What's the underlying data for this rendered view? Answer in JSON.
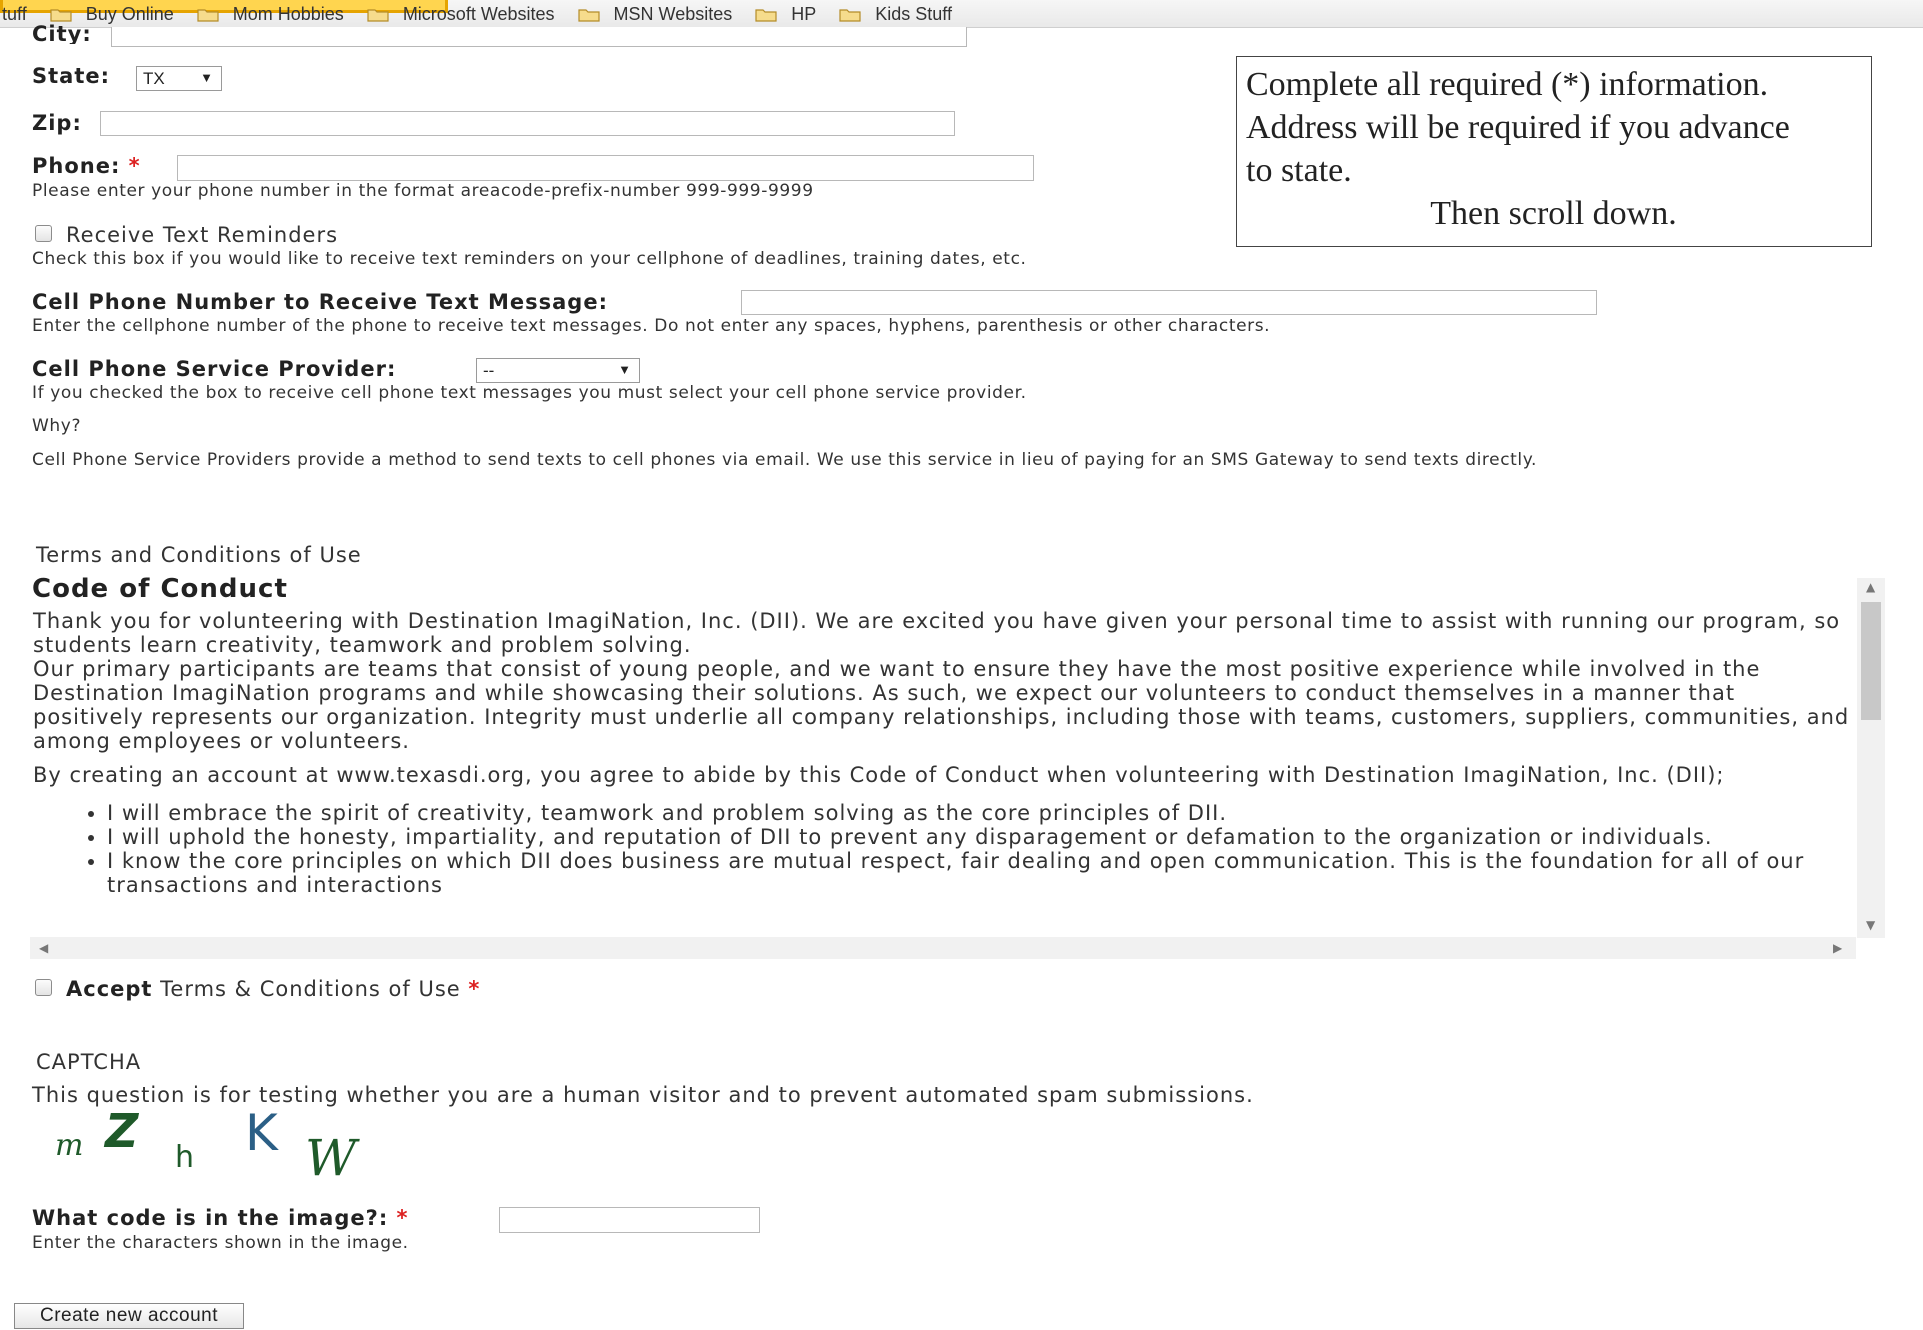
{
  "bookmarks": {
    "items": [
      "tuff",
      "Buy Online",
      "Mom Hobbies",
      "Microsoft Websites",
      "MSN Websites",
      "HP",
      "Kids Stuff"
    ]
  },
  "form": {
    "city_label": "City:",
    "state_label": "State:",
    "state_value": "TX",
    "zip_label": "Zip:",
    "phone_label": "Phone:",
    "required_mark": "*",
    "phone_desc": "Please enter your phone number in the format areacode-prefix-number 999-999-9999",
    "text_reminders_label": "Receive Text Reminders",
    "text_reminders_desc": "Check this box if you would like to receive text reminders on your cellphone of deadlines, training dates, etc.",
    "cell_number_label": "Cell Phone Number to Receive Text Message:",
    "cell_number_desc": "Enter the cellphone number of the phone to receive text messages. Do not enter any spaces, hyphens, parenthesis or other characters.",
    "provider_label": "Cell Phone Service Provider:",
    "provider_value": "--",
    "provider_desc": "If you checked the box to receive cell phone text messages you must select your cell phone service provider.",
    "why": "Why?",
    "why_desc": "Cell Phone Service Providers provide a method to send texts to cell phones via email. We use this service in lieu of paying for an SMS Gateway to send texts directly."
  },
  "notice": {
    "line1": "Complete all required (*) information.",
    "line2": "Address will be required if you advance",
    "line3": "to state.",
    "line4": "Then scroll down."
  },
  "terms": {
    "legend": "Terms and Conditions of Use",
    "heading": "Code of Conduct",
    "p1": "Thank you for volunteering with Destination ImagiNation, Inc. (DII). We are excited you have given your personal time to assist with running our program, so students learn creativity, teamwork and problem solving.",
    "p2": "Our primary participants are teams that consist of young people, and we want to ensure they have the most positive experience while involved in the Destination ImagiNation programs and while showcasing their solutions. As such, we expect our volunteers to conduct themselves in a manner that positively represents our organization. Integrity must underlie all company relationships, including those with teams, customers, suppliers, communities, and among employees or volunteers.",
    "p3": "By creating an account at www.texasdi.org, you agree to abide by this Code of Conduct when volunteering with Destination ImagiNation, Inc. (DII);",
    "bullets": [
      "I will embrace the spirit of creativity, teamwork and problem solving as the core principles of DII.",
      "I will uphold the honesty, impartiality, and reputation of DII to prevent any disparagement or defamation to the organization or individuals.",
      "I know the core principles on which DII does business are mutual respect, fair dealing and open communication. This is the foundation for all of our transactions and interactions"
    ],
    "accept_bold": "Accept",
    "accept_rest": "Terms & Conditions of Use"
  },
  "captcha": {
    "legend": "CAPTCHA",
    "desc": "This question is for testing whether you are a human visitor and to prevent automated spam submissions.",
    "question_label": "What code is in the image?:",
    "question_desc": "Enter the characters shown in the image."
  },
  "submit_label": "Create new account"
}
